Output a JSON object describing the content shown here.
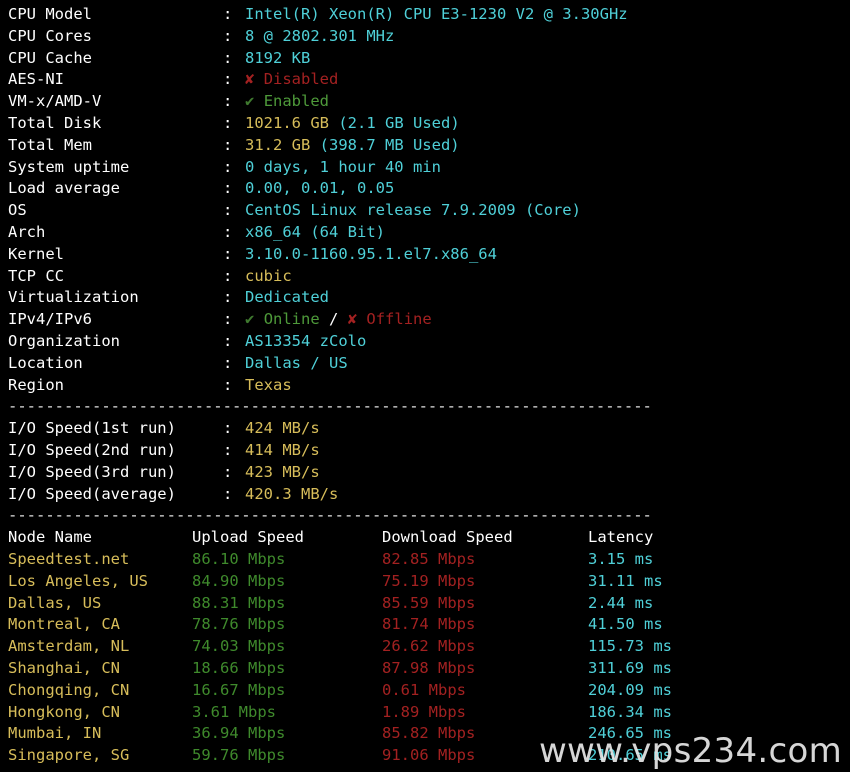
{
  "terminal": {
    "colon": ":",
    "separator": "---------------------------------------------------------------------",
    "watermark": "www.vps234.com"
  },
  "colors": {
    "background": "#000000",
    "label": "#ffffff",
    "cyan": "#4fd0d8",
    "yellow": "#d7bd5a",
    "green": "#3f8a2c",
    "red": "#a32121"
  },
  "system_info": [
    {
      "label": "CPU Model",
      "value": "Intel(R) Xeon(R) CPU E3-1230 V2 @ 3.30GHz",
      "color": "cyan"
    },
    {
      "label": "CPU Cores",
      "value": "8 @ 2802.301 MHz",
      "color": "cyan"
    },
    {
      "label": "CPU Cache",
      "value": "8192 KB",
      "color": "cyan"
    },
    {
      "label": "AES-NI",
      "value": "Disabled",
      "mark": "✘",
      "color": "red"
    },
    {
      "label": "VM-x/AMD-V",
      "value": "Enabled",
      "mark": "✔",
      "color": "green"
    },
    {
      "label": "Total Disk",
      "value": "1021.6 GB",
      "extra": " (2.1 GB Used)",
      "color": "yellow"
    },
    {
      "label": "Total Mem",
      "value": "31.2 GB",
      "extra": " (398.7 MB Used)",
      "color": "yellow"
    },
    {
      "label": "System uptime",
      "value": "0 days, 1 hour 40 min",
      "color": "cyan"
    },
    {
      "label": "Load average",
      "value": "0.00, 0.01, 0.05",
      "color": "cyan"
    },
    {
      "label": "OS",
      "value": "CentOS Linux release 7.9.2009 (Core)",
      "color": "cyan"
    },
    {
      "label": "Arch",
      "value": "x86_64 (64 Bit)",
      "color": "cyan"
    },
    {
      "label": "Kernel",
      "value": "3.10.0-1160.95.1.el7.x86_64",
      "color": "cyan"
    },
    {
      "label": "TCP CC",
      "value": "cubic",
      "color": "yellow"
    },
    {
      "label": "Virtualization",
      "value": "Dedicated",
      "color": "cyan"
    },
    {
      "label": "IPv4/IPv6",
      "value": "Online / Offline",
      "color": "mixed"
    },
    {
      "label": "Organization",
      "value": "AS13354 zColo",
      "color": "cyan"
    },
    {
      "label": "Location",
      "value": "Dallas / US",
      "color": "cyan"
    },
    {
      "label": "Region",
      "value": "Texas",
      "color": "yellow"
    }
  ],
  "network_status": {
    "ipv4_mark": "✔",
    "ipv4_label": "Online",
    "divider": " / ",
    "ipv6_mark": "✘",
    "ipv6_label": "Offline"
  },
  "io_speed": [
    {
      "label": "I/O Speed(1st run)",
      "value": "424 MB/s"
    },
    {
      "label": "I/O Speed(2nd run)",
      "value": "414 MB/s"
    },
    {
      "label": "I/O Speed(3rd run)",
      "value": "423 MB/s"
    },
    {
      "label": "I/O Speed(average)",
      "value": "420.3 MB/s"
    }
  ],
  "speedtest": {
    "headers": {
      "node": "Node Name",
      "upload": "Upload Speed",
      "download": "Download Speed",
      "latency": "Latency"
    },
    "rows": [
      {
        "node": "Speedtest.net",
        "upload": "86.10 Mbps",
        "download": "82.85 Mbps",
        "latency": "3.15 ms"
      },
      {
        "node": "Los Angeles, US",
        "upload": "84.90 Mbps",
        "download": "75.19 Mbps",
        "latency": "31.11 ms"
      },
      {
        "node": "Dallas, US",
        "upload": "88.31 Mbps",
        "download": "85.59 Mbps",
        "latency": "2.44 ms"
      },
      {
        "node": "Montreal, CA",
        "upload": "78.76 Mbps",
        "download": "81.74 Mbps",
        "latency": "41.50 ms"
      },
      {
        "node": "Amsterdam, NL",
        "upload": "74.03 Mbps",
        "download": "26.62 Mbps",
        "latency": "115.73 ms"
      },
      {
        "node": "Shanghai, CN",
        "upload": "18.66 Mbps",
        "download": "87.98 Mbps",
        "latency": "311.69 ms"
      },
      {
        "node": "Chongqing, CN",
        "upload": "16.67 Mbps",
        "download": "0.61 Mbps",
        "latency": "204.09 ms"
      },
      {
        "node": "Hongkong, CN",
        "upload": "3.61 Mbps",
        "download": "1.89 Mbps",
        "latency": "186.34 ms"
      },
      {
        "node": "Mumbai, IN",
        "upload": "36.94 Mbps",
        "download": "85.82 Mbps",
        "latency": "246.65 ms"
      },
      {
        "node": "Singapore, SG",
        "upload": "59.76 Mbps",
        "download": "91.06 Mbps",
        "latency": "210.65 ms"
      }
    ]
  }
}
